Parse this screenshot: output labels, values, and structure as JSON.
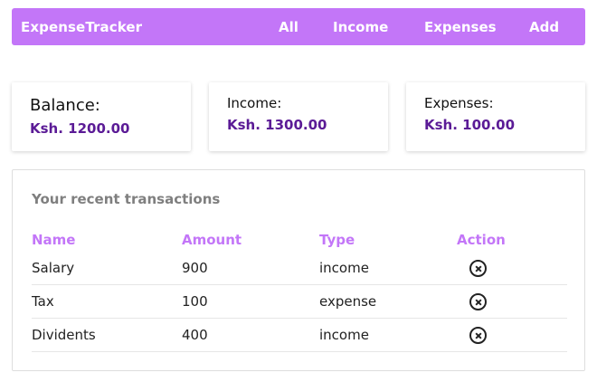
{
  "navbar": {
    "brand": "ExpenseTracker",
    "links": [
      "All",
      "Income",
      "Expenses",
      "Add"
    ]
  },
  "summary": {
    "balance": {
      "label": "Balance:",
      "value": "Ksh. 1200.00"
    },
    "income": {
      "label": "Income:",
      "value": "Ksh. 1300.00"
    },
    "expenses": {
      "label": "Expenses:",
      "value": "Ksh. 100.00"
    }
  },
  "transactions": {
    "title": "Your recent transactions",
    "headers": [
      "Name",
      "Amount",
      "Type",
      "Action"
    ],
    "rows": [
      {
        "name": "Salary",
        "amount": "900",
        "type": "income",
        "action_icon": "remove-circle-icon"
      },
      {
        "name": "Tax",
        "amount": "100",
        "type": "expense",
        "action_icon": "remove-circle-icon"
      },
      {
        "name": "Dividents",
        "amount": "400",
        "type": "income",
        "action_icon": "remove-circle-icon"
      }
    ]
  },
  "colors": {
    "navbar_bg": "#c376f8",
    "accent_text": "#5b1b96",
    "header_text": "#c376f8"
  }
}
